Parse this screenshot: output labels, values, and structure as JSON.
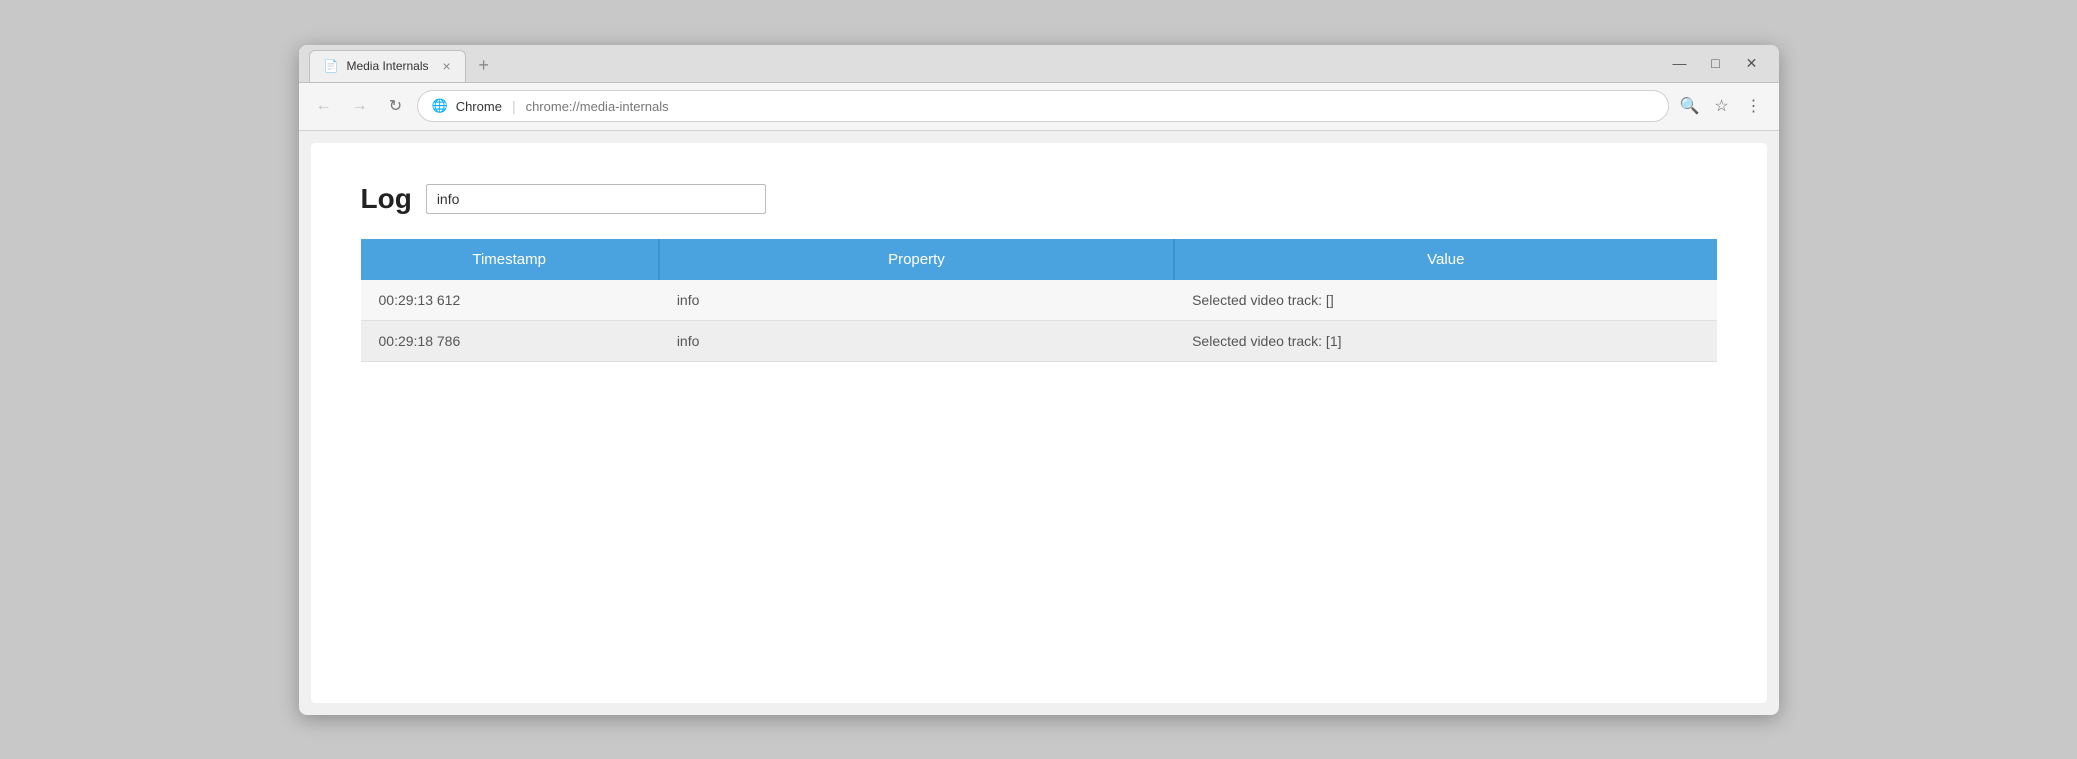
{
  "browser": {
    "tab_title": "Media Internals",
    "tab_icon": "📄",
    "tab_close_icon": "×",
    "new_tab_icon": "+",
    "win_minimize": "—",
    "win_maximize": "□",
    "win_close": "✕",
    "nav_back": "←",
    "nav_forward": "→",
    "nav_reload": "↻",
    "url_secure_icon": "🌐",
    "url_site": "Chrome",
    "url_separator": "|",
    "url_path": "chrome://media-internals",
    "search_icon": "🔍",
    "star_icon": "☆",
    "menu_icon": "⋮"
  },
  "page": {
    "log_label": "Log",
    "log_input_value": "info",
    "log_input_placeholder": "",
    "table": {
      "headers": [
        "Timestamp",
        "Property",
        "Value"
      ],
      "rows": [
        {
          "timestamp": "00:29:13 612",
          "property": "info",
          "value": "Selected video track: []"
        },
        {
          "timestamp": "00:29:18 786",
          "property": "info",
          "value": "Selected video track: [1]"
        }
      ]
    }
  }
}
